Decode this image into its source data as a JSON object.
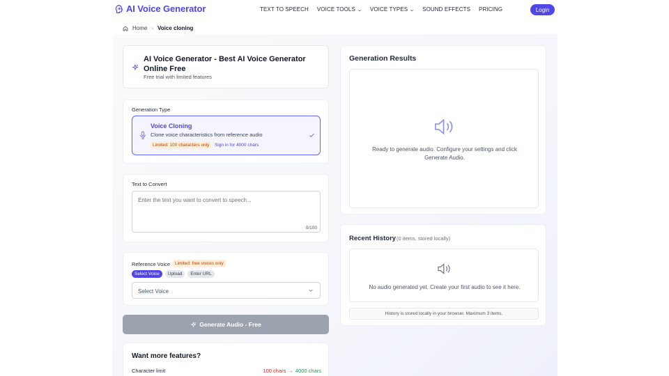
{
  "header": {
    "logo_text": "AI Voice Generator",
    "nav": [
      {
        "label": "TEXT TO SPEECH",
        "has_dropdown": false
      },
      {
        "label": "VOICE TOOLS",
        "has_dropdown": true
      },
      {
        "label": "VOICE TYPES",
        "has_dropdown": true
      },
      {
        "label": "SOUND EFFECTS",
        "has_dropdown": false
      },
      {
        "label": "PRICING",
        "has_dropdown": false
      }
    ],
    "login_label": "Login"
  },
  "breadcrumb": {
    "home": "Home",
    "current": "Voice cloning"
  },
  "intro": {
    "title": "AI Voice Generator - Best AI Voice Generator Online Free",
    "subtitle": "Free trial with limited features"
  },
  "generation_type": {
    "label": "Generation Type",
    "option_title": "Voice Cloning",
    "option_desc": "Clone voice characteristics from reference audio",
    "limit_badge": "Limited: 100 characters only",
    "signin_link": "Sign in for 4000 chars"
  },
  "text_input": {
    "label": "Text to Convert",
    "placeholder": "Enter the text you want to convert to speech...",
    "counter": "0/100"
  },
  "reference_voice": {
    "label": "Reference Voice",
    "badge": "Limited: free voices only",
    "tabs": [
      "Select Voice",
      "Upload",
      "Enter URL"
    ],
    "select_placeholder": "Select Voice"
  },
  "generate_button": "Generate Audio - Free",
  "features": {
    "title": "Want more features?",
    "row_label": "Character limit",
    "old_value": "100 chars",
    "arrow": "→",
    "new_value": "4000 chars"
  },
  "results": {
    "title": "Generation Results",
    "ready_text": "Ready to generate audio. Configure your settings and click Generate Audio."
  },
  "history": {
    "title": "Recent History",
    "meta": "(0 items, stored locally)",
    "empty_text": "No audio generated yet. Create your first audio to see it here.",
    "note": "History is stored locally in your browser. Maximum 3 items."
  },
  "colors": {
    "accent": "#4f46e5",
    "disabled_button": "#9ca3af",
    "warning_bg": "#ffedd5",
    "warning_text": "#c2410c"
  }
}
